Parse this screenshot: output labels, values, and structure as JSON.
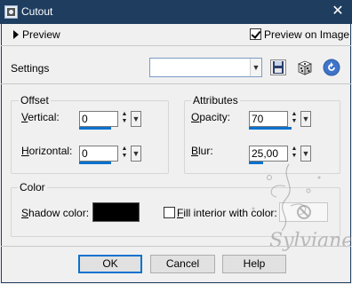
{
  "window": {
    "title": "Cutout",
    "close_glyph": "✕",
    "icon": "cutout-app-icon"
  },
  "preview": {
    "expander_label": "Preview",
    "preview_on_image_label": "Preview on Image",
    "preview_on_image_checked": true
  },
  "settings": {
    "label": "Settings",
    "combo_value": "",
    "icons": [
      "save-preset-icon",
      "random-dice-icon",
      "reset-icon"
    ]
  },
  "offset": {
    "title": "Offset",
    "vertical_label": "Vertical:",
    "vertical_value": "0",
    "horizontal_label": "Horizontal:",
    "horizontal_value": "0"
  },
  "attributes": {
    "title": "Attributes",
    "opacity_label": "Opacity:",
    "opacity_value": "70",
    "blur_label": "Blur:",
    "blur_value": "25,00"
  },
  "color": {
    "title": "Color",
    "shadow_label": "Shadow color:",
    "shadow_color": "#000000",
    "fill_label": "Fill interior with color:",
    "fill_checked": false
  },
  "buttons": {
    "ok": "OK",
    "cancel": "Cancel",
    "help": "Help"
  },
  "watermark": {
    "text": "Sylviane"
  },
  "colors": {
    "titlebar": "#1f3d5f",
    "accent": "#0a72cf"
  }
}
